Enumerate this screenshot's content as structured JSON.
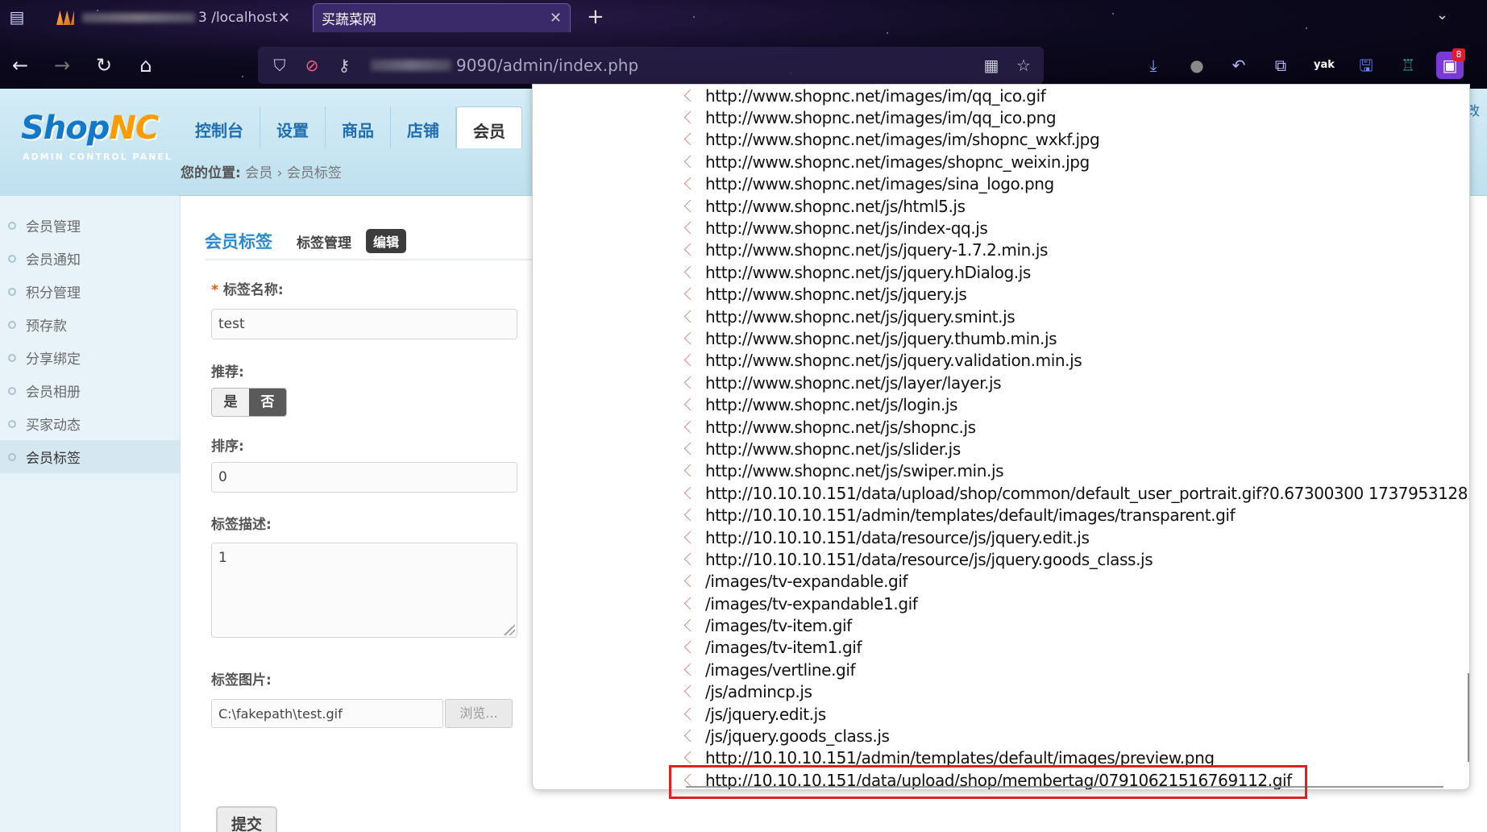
{
  "browser": {
    "tab1_title": "3 /localhost",
    "tab2_title": "买蔬菜网",
    "url": "9090/admin/index.php",
    "ext_badge": "8",
    "yak_label": "yak"
  },
  "admin": {
    "logo_text_a": "Shop",
    "logo_text_b": "NC",
    "logo_sub": "ADMIN CONTROL PANEL",
    "nav": [
      "控制台",
      "设置",
      "商品",
      "店铺",
      "会员"
    ],
    "breadcrumb_label": "您的位置:",
    "breadcrumb_1": "会员",
    "breadcrumb_sep": "›",
    "breadcrumb_2": "会员标签",
    "right_edge_text": "改"
  },
  "sidebar": {
    "items": [
      "会员管理",
      "会员通知",
      "积分管理",
      "预存款",
      "分享绑定",
      "会员相册",
      "买家动态",
      "会员标签"
    ]
  },
  "form": {
    "title": "会员标签",
    "link_manage": "标签管理",
    "link_edit": "编辑",
    "name_label": "标签名称:",
    "name_required": "*",
    "name_value": "test",
    "recommend_label": "推荐:",
    "rec_yes": "是",
    "rec_no": "否",
    "sort_label": "排序:",
    "sort_value": "0",
    "desc_label": "标签描述:",
    "desc_value": "1",
    "image_label": "标签图片:",
    "image_value": "C:\\fakepath\\test.gif",
    "browse_label": "浏览...",
    "submit_label": "提交"
  },
  "popup": {
    "urls": [
      "http://www.shopnc.net/images/im/qq_ico.gif",
      "http://www.shopnc.net/images/im/qq_ico.png",
      "http://www.shopnc.net/images/im/shopnc_wxkf.jpg",
      "http://www.shopnc.net/images/shopnc_weixin.jpg",
      "http://www.shopnc.net/images/sina_logo.png",
      "http://www.shopnc.net/js/html5.js",
      "http://www.shopnc.net/js/index-qq.js",
      "http://www.shopnc.net/js/jquery-1.7.2.min.js",
      "http://www.shopnc.net/js/jquery.hDialog.js",
      "http://www.shopnc.net/js/jquery.js",
      "http://www.shopnc.net/js/jquery.smint.js",
      "http://www.shopnc.net/js/jquery.thumb.min.js",
      "http://www.shopnc.net/js/jquery.validation.min.js",
      "http://www.shopnc.net/js/layer/layer.js",
      "http://www.shopnc.net/js/login.js",
      "http://www.shopnc.net/js/shopnc.js",
      "http://www.shopnc.net/js/slider.js",
      "http://www.shopnc.net/js/swiper.min.js",
      "http://10.10.10.151/data/upload/shop/common/default_user_portrait.gif?0.67300300 1737953128",
      "http://10.10.10.151/admin/templates/default/images/transparent.gif",
      "http://10.10.10.151/data/resource/js/jquery.edit.js",
      "http://10.10.10.151/data/resource/js/jquery.goods_class.js",
      "/images/tv-expandable.gif",
      "/images/tv-expandable1.gif",
      "/images/tv-item.gif",
      "/images/tv-item1.gif",
      "/images/vertline.gif",
      "/js/admincp.js",
      "/js/jquery.edit.js",
      "/js/jquery.goods_class.js",
      "http://10.10.10.151/admin/templates/default/images/preview.png",
      "http://10.10.10.151/data/upload/shop/membertag/07910621516769112.gif"
    ]
  }
}
